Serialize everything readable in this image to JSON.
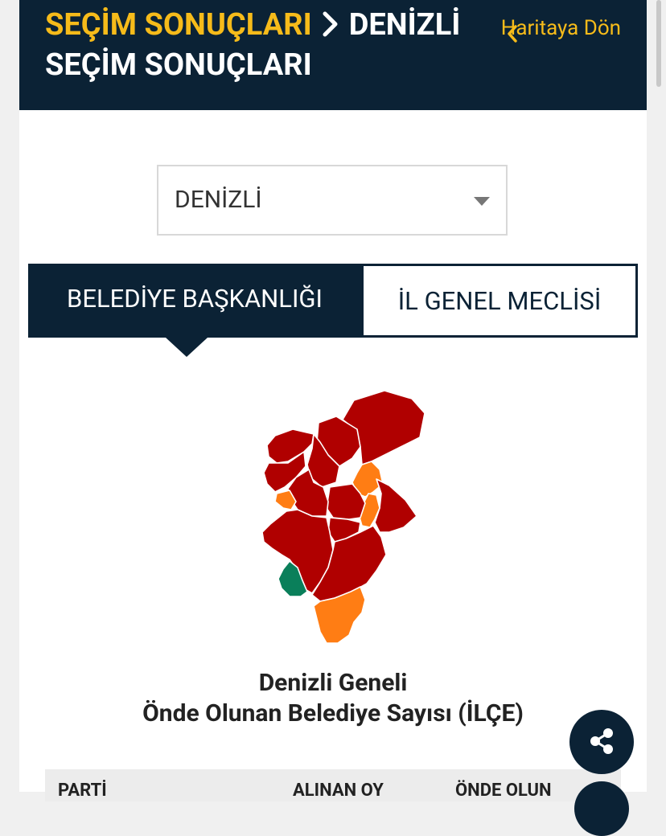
{
  "header": {
    "breadcrumb_root": "SEÇİM SONUÇLARI",
    "breadcrumb_current": "DENİZLİ",
    "breadcrumb_line2": "SEÇİM SONUÇLARI",
    "back_link": "Haritaya Dön"
  },
  "province_select": {
    "value": "DENİZLİ"
  },
  "tabs": [
    {
      "label": "BELEDİYE BAŞKANLIĞI",
      "active": true
    },
    {
      "label": "İL GENEL MECLİSİ",
      "active": false
    }
  ],
  "map": {
    "colors": {
      "dark_red": "#b00000",
      "orange": "#ff7d14",
      "green": "#0a7f5a",
      "border": "#ffffff"
    }
  },
  "summary": {
    "title": "Denizli Geneli",
    "subtitle": "Önde Olunan Belediye Sayısı (İLÇE)"
  },
  "table": {
    "columns": [
      "PARTİ",
      "ALINAN OY",
      "ÖNDE OLUN"
    ]
  },
  "colors": {
    "navy": "#0b2235",
    "gold": "#f6bb1a"
  },
  "icons": {
    "share": "share-icon",
    "back": "chevron-left-icon",
    "separator": "chevron-right-icon"
  }
}
